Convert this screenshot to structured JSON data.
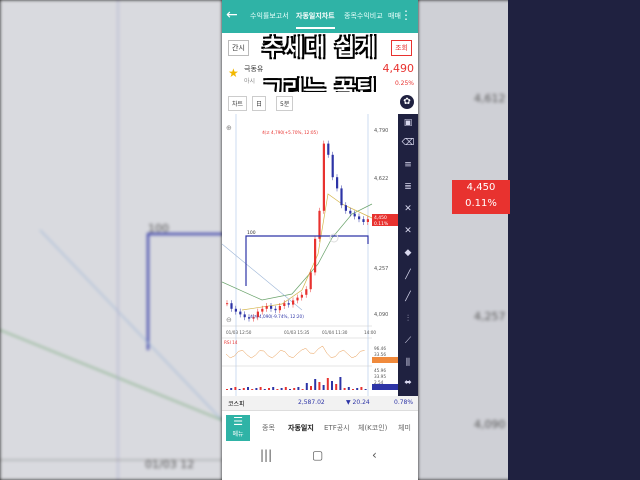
{
  "header": {
    "back": "←",
    "tabs": [
      "수익률보고서",
      "자동일지차트",
      "종목수익비교",
      "매매"
    ],
    "active_tab": 1,
    "menu": "⋮"
  },
  "overlay": {
    "line1": "추세대 쉽게",
    "line2": "그리는 꿀팁"
  },
  "stock": {
    "chip_left": "간시",
    "chip_right": "조회",
    "name": "극동유",
    "sub": "아시",
    "price": "4,490",
    "change": "0.25%"
  },
  "controls": {
    "chart": "차트",
    "period": "5분",
    "interval": "日"
  },
  "chart_data": {
    "type": "candlestick",
    "price_ticks": [
      "4,790",
      "4,622",
      "4,450",
      "4,257",
      "4,090"
    ],
    "time_ticks": [
      "01/03 12:50",
      "01/03 15:35",
      "01/04 11:30",
      "14:00"
    ],
    "high_label": "최고 4,790(+5.70%, 12:05)",
    "low_label": "최저 4,090(-9.74%, 12:20)",
    "box_label": "100",
    "current_price": "4,450",
    "current_pct": "0.11%",
    "rsi_label": "RSI 14",
    "rsi_values": [
      "96.46",
      "33.56"
    ],
    "volume_values": [
      "45.96",
      "33.95",
      "2.54"
    ],
    "series": [
      {
        "values": [
          4150,
          4130,
          4120,
          4110,
          4100,
          4095,
          4100,
          4120,
          4130,
          4140,
          4130,
          4125,
          4140,
          4150,
          4145,
          4160,
          4170,
          4180,
          4200,
          4260,
          4380,
          4480,
          4720,
          4680,
          4600,
          4560,
          4500,
          4480,
          4470,
          4460,
          4450,
          4440,
          4450
        ]
      }
    ]
  },
  "status": {
    "label": "코스피",
    "value": "2,587.02",
    "change": "▼ 20.24",
    "pct": "0.78%"
  },
  "nav": {
    "menu_label": "메뉴",
    "items": [
      "종목",
      "자동일지",
      "ETF공시",
      "체(K코인)",
      "체미"
    ]
  },
  "background": {
    "left_label_100": "100",
    "left_date": "01/03 12",
    "right_tick_top": "4,612",
    "right_tick_mid": "4,257",
    "right_tick_low": "4,090",
    "right_price": "4,450",
    "right_pct": "0.11%"
  },
  "colors": {
    "teal": "#2fb3a6",
    "red": "#e8322f",
    "navy": "#1f2140",
    "blue": "#2d34a6"
  }
}
